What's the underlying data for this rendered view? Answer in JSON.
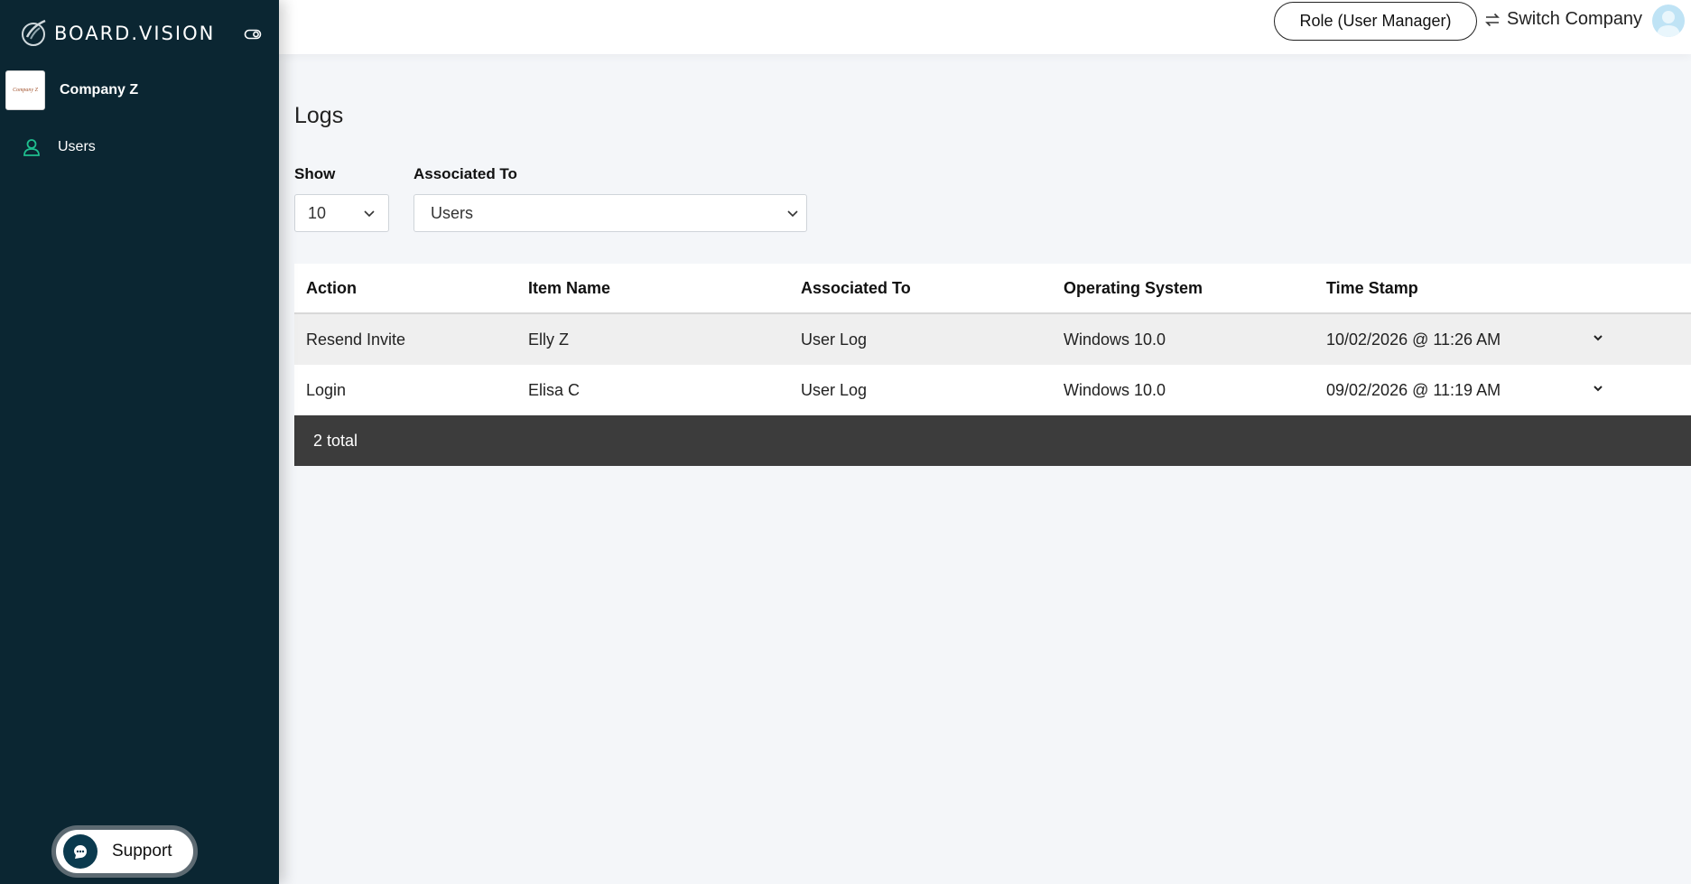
{
  "brand": {
    "name": "BOARD.VISION"
  },
  "company": {
    "name": "Company Z",
    "logo_text": "Company Z"
  },
  "sidebar": {
    "items": [
      {
        "label": "Users",
        "icon": "user-icon"
      }
    ]
  },
  "support": {
    "label": "Support"
  },
  "header": {
    "role_label": "Role (User Manager)",
    "switch_label": "Switch Company"
  },
  "page": {
    "title": "Logs"
  },
  "filters": {
    "show_label": "Show",
    "show_value": "10",
    "assoc_label": "Associated To",
    "assoc_value": "Users"
  },
  "table": {
    "columns": [
      "Action",
      "Item Name",
      "Associated To",
      "Operating System",
      "Time Stamp"
    ],
    "rows": [
      [
        "Resend Invite",
        "Elly Z",
        "User Log",
        "Windows 10.0",
        "10/02/2026 @ 11:26 AM"
      ],
      [
        "Login",
        "Elisa C",
        "User Log",
        "Windows 10.0",
        "09/02/2026 @ 11:19 AM"
      ]
    ],
    "footer": "2 total"
  },
  "colors": {
    "sidebar_bg": "#0b2632",
    "accent": "#1fbf8f",
    "footer_bg": "#3c3c3c"
  }
}
